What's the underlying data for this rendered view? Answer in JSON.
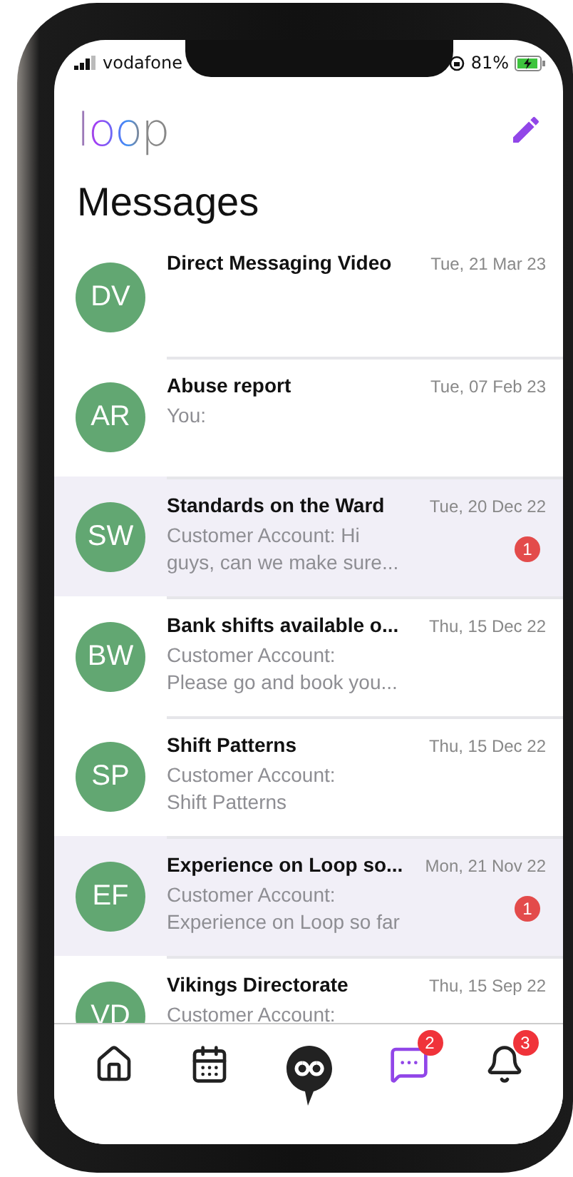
{
  "status_bar": {
    "carrier": "vodafone",
    "battery": "81%"
  },
  "header": {
    "logo": "loop"
  },
  "title": "Messages",
  "conversations": [
    {
      "initials": "DV",
      "title": "Direct Messaging Video",
      "date": "Tue, 21 Mar 23",
      "unread": false
    },
    {
      "initials": "AR",
      "title": "Abuse report",
      "date": "Tue, 07 Feb 23",
      "preview": [
        "You:"
      ],
      "unread": false
    },
    {
      "initials": "SW",
      "title": "Standards on the Ward",
      "date": "Tue, 20 Dec 22",
      "preview": [
        "Customer Account: Hi",
        "guys, can we make sure..."
      ],
      "unread": true,
      "badge": "1"
    },
    {
      "initials": "BW",
      "title": "Bank shifts available o...",
      "date": "Thu, 15 Dec 22",
      "preview": [
        "Customer Account:",
        "Please go and book you..."
      ],
      "unread": false
    },
    {
      "initials": "SP",
      "title": "Shift Patterns",
      "date": "Thu, 15 Dec 22",
      "preview": [
        "Customer Account:",
        "Shift Patterns"
      ],
      "unread": false
    },
    {
      "initials": "EF",
      "title": "Experience on Loop so...",
      "date": "Mon, 21 Nov 22",
      "preview": [
        "Customer Account:",
        "Experience on Loop so far"
      ],
      "unread": true,
      "badge": "1"
    },
    {
      "initials": "VD",
      "title": "Vikings Directorate",
      "date": "Thu, 15 Sep 22",
      "preview": [
        "Customer Account:"
      ],
      "unread": false
    }
  ],
  "tab_bar": [
    {
      "kind": "home",
      "selected": false
    },
    {
      "kind": "calendar",
      "selected": false
    },
    {
      "kind": "loop",
      "selected": false
    },
    {
      "kind": "messages",
      "selected": true,
      "badge": "2"
    },
    {
      "kind": "notifications",
      "selected": false,
      "badge": "3"
    }
  ]
}
